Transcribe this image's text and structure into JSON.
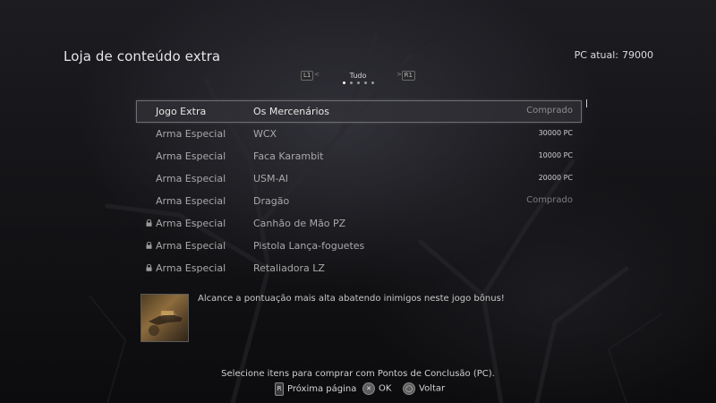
{
  "header": {
    "title": "Loja de conteúdo extra",
    "points_label": "PC atual:",
    "points_value": "79000"
  },
  "tabs": {
    "left_button": "L1",
    "right_button": "R1",
    "left_arrow": "<",
    "right_arrow": ">",
    "current": "Tudo",
    "page_count": 5,
    "active_index": 0
  },
  "items": [
    {
      "category": "Jogo Extra",
      "name": "Os Mercenários",
      "status": "Comprado",
      "locked": false,
      "selected": true
    },
    {
      "category": "Arma Especial",
      "name": "WCX",
      "status": "30000 PC",
      "locked": false,
      "selected": false
    },
    {
      "category": "Arma Especial",
      "name": "Faca Karambit",
      "status": "10000 PC",
      "locked": false,
      "selected": false
    },
    {
      "category": "Arma Especial",
      "name": "USM-AI",
      "status": "20000 PC",
      "locked": false,
      "selected": false
    },
    {
      "category": "Arma Especial",
      "name": "Dragão",
      "status": "Comprado",
      "locked": false,
      "selected": false
    },
    {
      "category": "Arma Especial",
      "name": "Canhão de Mão PZ",
      "status": "",
      "locked": true,
      "selected": false
    },
    {
      "category": "Arma Especial",
      "name": "Pistola Lança-foguetes",
      "status": "",
      "locked": true,
      "selected": false
    },
    {
      "category": "Arma Especial",
      "name": "Retaliadora LZ",
      "status": "",
      "locked": true,
      "selected": false
    }
  ],
  "description": {
    "text": "Alcance a pontuação mais alta abatendo inimigos neste jogo bônus!",
    "image_icon": "mercenaries-thumbnail"
  },
  "footer": {
    "instruction": "Selecione itens para comprar com Pontos de Conclusão (PC).",
    "controls": [
      {
        "icon": "r-button-icon",
        "glyph": "R",
        "label": "Próxima página"
      },
      {
        "icon": "cross-button-icon",
        "glyph": "✕",
        "label": "OK"
      },
      {
        "icon": "circle-button-icon",
        "glyph": "◯",
        "label": "Voltar"
      }
    ]
  },
  "colors": {
    "purchased": "#7d7d7d",
    "price": "#cfcfcf",
    "selected_border": "#6f6f72"
  }
}
